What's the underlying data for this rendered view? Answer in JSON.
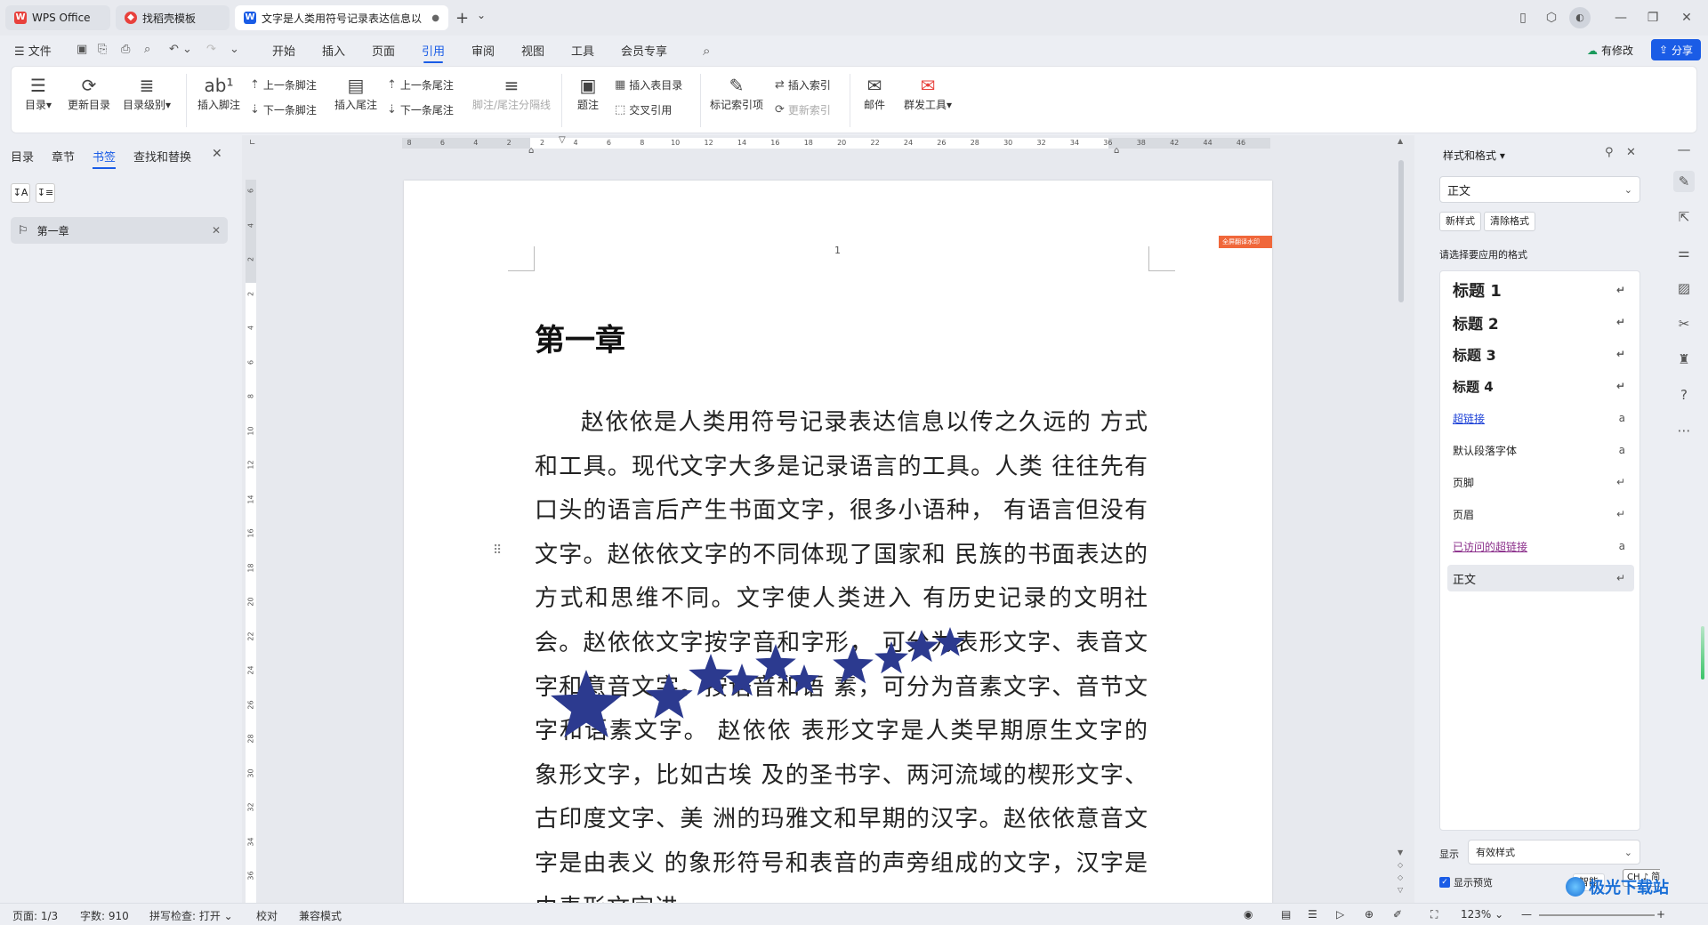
{
  "tabs": {
    "wps_label": "WPS Office",
    "template_label": "找稻壳模板",
    "doc_label": "文字是人类用符号记录表达信息以",
    "add": "+",
    "add_menu": "⌄"
  },
  "menubar": {
    "file": "文件",
    "items": [
      "开始",
      "插入",
      "页面",
      "引用",
      "审阅",
      "视图",
      "工具",
      "会员专享"
    ],
    "modified": "有修改",
    "share": "分享"
  },
  "ribbon": {
    "toc": "目录",
    "update_toc": "更新目录",
    "toc_level": "目录级别",
    "insert_footnote": "插入脚注",
    "prev_footnote": "上一条脚注",
    "next_footnote": "下一条脚注",
    "insert_endnote": "插入尾注",
    "prev_endnote": "上一条尾注",
    "next_endnote": "下一条尾注",
    "footnote_sep": "脚注/尾注分隔线",
    "caption": "题注",
    "insert_table_toc": "插入表目录",
    "cross_ref": "交叉引用",
    "mark_index": "标记索引项",
    "insert_index": "插入索引",
    "update_index": "更新索引",
    "mail": "邮件",
    "mass_tool": "群发工具"
  },
  "leftpanel": {
    "tabs": [
      "目录",
      "章节",
      "书签",
      "查找和替换"
    ],
    "bookmark": "第一章"
  },
  "ruler": {
    "h_ticks": [
      "8",
      "6",
      "4",
      "2",
      "2",
      "4",
      "6",
      "8",
      "10",
      "12",
      "14",
      "16",
      "18",
      "20",
      "22",
      "24",
      "26",
      "28",
      "30",
      "32",
      "34",
      "36",
      "38",
      "42",
      "44",
      "46"
    ],
    "v_ticks": [
      "6",
      "4",
      "2",
      "2",
      "4",
      "6",
      "8",
      "10",
      "12",
      "14",
      "16",
      "18",
      "20",
      "22",
      "24",
      "26",
      "28",
      "30",
      "32",
      "34",
      "36",
      "38"
    ]
  },
  "document": {
    "page_number": "1",
    "tag": "全屏翻译水印",
    "heading": "第一章",
    "body": "赵依依是人类用符号记录表达信息以传之久远的 方式和工具。现代文字大多是记录语言的工具。人类 往往先有口头的语言后产生书面文字，很多小语种， 有语言但没有文字。赵依依文字的不同体现了国家和 民族的书面表达的方式和思维不同。文字使人类进入 有历史记录的文明社会。赵依依文字按字音和字形， 可分为表形文字、表音文字和意音文字。按语音和语 素，可分为音素文字、音节文字和语素文字。 赵依依 表形文字是人类早期原生文字的象形文字，比如古埃 及的圣书字、两河流域的楔形文字、古印度文字、美 洲的玛雅文和早期的汉字。赵依依意音文字是由表义 的象形符号和表音的声旁组成的文字，汉字是由表形文字进"
  },
  "rightpanel": {
    "title": "样式和格式",
    "current_style": "正文",
    "new_style": "新样式",
    "clear_format": "清除格式",
    "prompt": "请选择要应用的格式",
    "styles": [
      {
        "label": "标题 1",
        "mark": "↵"
      },
      {
        "label": "标题 2",
        "mark": "↵"
      },
      {
        "label": "标题 3",
        "mark": "↵"
      },
      {
        "label": "标题 4",
        "mark": "↵"
      },
      {
        "label": "超链接",
        "mark": "a"
      },
      {
        "label": "默认段落字体",
        "mark": "a"
      },
      {
        "label": "页脚",
        "mark": "↵"
      },
      {
        "label": "页眉",
        "mark": "↵"
      },
      {
        "label": "已访问的超链接",
        "mark": "a"
      },
      {
        "label": "正文",
        "mark": "↵"
      }
    ],
    "show_label": "显示",
    "show_value": "有效样式",
    "preview_label": "显示预览",
    "smart": "智能",
    "ime": "CH ♪ 简"
  },
  "status": {
    "page": "页面: 1/3",
    "words": "字数: 910",
    "spell": "拼写检查: 打开",
    "proof": "校对",
    "compat": "兼容模式",
    "zoom": "123%"
  },
  "watermark": "极光下载站",
  "colors": {
    "accent": "#1a5ce6",
    "star": "#2c3a8f",
    "wps_red": "#e8413c",
    "visited": "#8a2d8a"
  }
}
